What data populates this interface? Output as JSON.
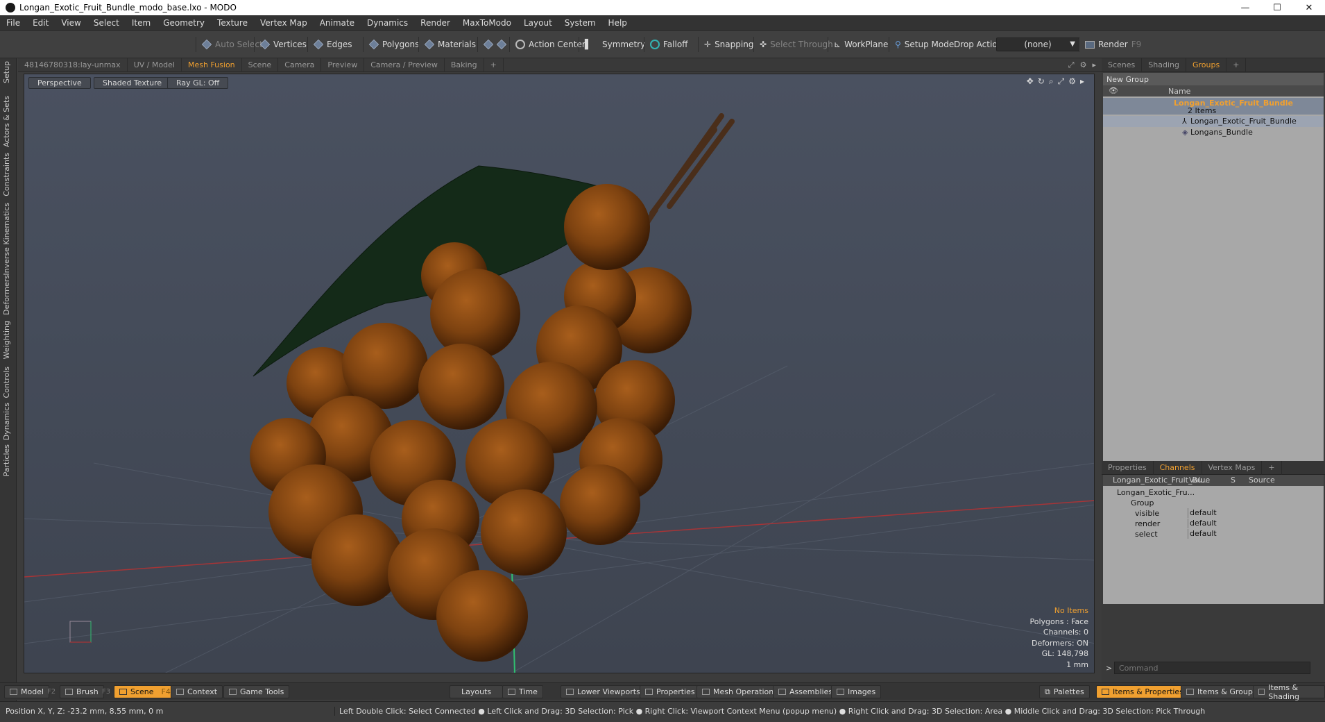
{
  "window": {
    "title": "Longan_Exotic_Fruit_Bundle_modo_base.lxo - MODO",
    "minimize": "—",
    "maximize": "☐",
    "close": "✕"
  },
  "menu": [
    "File",
    "Edit",
    "View",
    "Select",
    "Item",
    "Geometry",
    "Texture",
    "Vertex Map",
    "Animate",
    "Dynamics",
    "Render",
    "MaxToModo",
    "Layout",
    "System",
    "Help"
  ],
  "toolbar": {
    "auto_select": "Auto Select",
    "vertices": "Vertices",
    "edges": "Edges",
    "polygons": "Polygons",
    "materials": "Materials",
    "action_center": "Action Center",
    "symmetry": "Symmetry",
    "falloff": "Falloff",
    "snapping": "Snapping",
    "select_through": "Select Through",
    "workplane": "WorkPlane",
    "setup_mode": "Setup Mode",
    "drop_action": "Drop Action",
    "drop_value": "(none)",
    "render": "Render",
    "render_key": "F9"
  },
  "left_tabs": [
    "Setup",
    "Actors & Sets",
    "Constraints",
    "Inverse Kinematics",
    "Deformers",
    "Weighting",
    "Controls",
    "Dynamics",
    "Particles"
  ],
  "viewport_tabs": [
    "48146780318:lay-unmax",
    "UV / Model",
    "Mesh Fusion",
    "Scene",
    "Camera",
    "Preview",
    "Camera / Preview",
    "Baking",
    "+"
  ],
  "viewport": {
    "perspective": "Perspective",
    "shading": "Shaded Texture",
    "raygl": "Ray GL: Off",
    "info": {
      "items": "No Items",
      "polygons": "Polygons : Face",
      "channels": "Channels: 0",
      "deformers": "Deformers: ON",
      "gl": "GL: 148,798",
      "scale": "1 mm"
    }
  },
  "right_tabs_top": [
    "Scenes",
    "Shading",
    "Groups",
    "+"
  ],
  "groups": {
    "new_group": "New Group",
    "col_name": "Name",
    "root": "Longan_Exotic_Fruit_Bundle",
    "root_count": "2 Items",
    "children": [
      "Longan_Exotic_Fruit_Bundle",
      "Longans_Bundle"
    ]
  },
  "right_tabs_bottom": [
    "Properties",
    "Channels",
    "Vertex Maps",
    "+"
  ],
  "channels": {
    "col_item": "Longan_Exotic_Fruit_Bu...",
    "col_value": "Value",
    "col_s": "S",
    "col_source": "Source",
    "item": "Longan_Exotic_Fru...",
    "group": "Group",
    "rows": [
      {
        "name": "visible",
        "value": "default"
      },
      {
        "name": "render",
        "value": "default"
      },
      {
        "name": "select",
        "value": "default"
      }
    ]
  },
  "command": {
    "prompt": ">",
    "placeholder": "Command"
  },
  "bottom_left": [
    {
      "label": "Model",
      "key": "F2"
    },
    {
      "label": "Brush",
      "key": "F3"
    },
    {
      "label": "Scene",
      "key": "F4"
    },
    {
      "label": "Context",
      "key": ""
    },
    {
      "label": "Game Tools",
      "key": ""
    }
  ],
  "bottom_center": [
    "Layouts",
    "Time",
    "Lower Viewports",
    "Properties",
    "Mesh Operations",
    "Assemblies",
    "Images"
  ],
  "bottom_right": [
    "Palettes",
    "Items & Properties",
    "Items & Groups",
    "Items & Shading"
  ],
  "status": {
    "position": "Position X, Y, Z:  -23.2 mm, 8.55 mm, 0 m",
    "hint": "Left Double Click: Select Connected ● Left Click and Drag: 3D Selection: Pick ● Right Click: Viewport Context Menu (popup menu) ● Right Click and Drag: 3D Selection: Area ● Middle Click and Drag: 3D Selection: Pick Through"
  },
  "colors": {
    "accent": "#f0a030",
    "fruit": "#8b4a12",
    "leaf": "#142a18"
  }
}
